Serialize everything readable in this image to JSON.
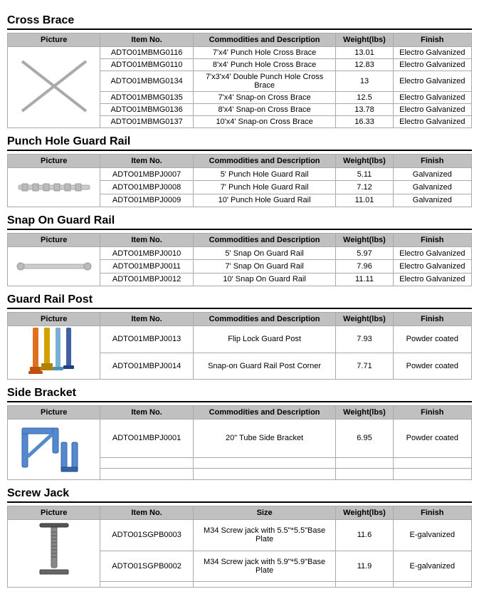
{
  "sections": [
    {
      "id": "cross-brace",
      "title": "Cross Brace",
      "headers": [
        "Picture",
        "Item No.",
        "Commodities and Description",
        "Weight(lbs)",
        "Finish"
      ],
      "rows": [
        {
          "item": "ADTO01MBMG0116",
          "desc": "7'x4' Punch Hole Cross Brace",
          "weight": "13.01",
          "finish": "Electro Galvanized"
        },
        {
          "item": "ADTO01MBMG0110",
          "desc": "8'x4' Punch Hole Cross Brace",
          "weight": "12.83",
          "finish": "Electro Galvanized"
        },
        {
          "item": "ADTO01MBMG0134",
          "desc": "7'x3'x4' Double Punch Hole Cross Brace",
          "weight": "13",
          "finish": "Electro Galvanized"
        },
        {
          "item": "ADTO01MBMG0135",
          "desc": "7'x4' Snap-on Cross Brace",
          "weight": "12.5",
          "finish": "Electro Galvanized"
        },
        {
          "item": "ADTO01MBMG0136",
          "desc": "8'x4' Snap-on Cross Brace",
          "weight": "13.78",
          "finish": "Electro Galvanized"
        },
        {
          "item": "ADTO01MBMG0137",
          "desc": "10'x4' Snap-on Cross Brace",
          "weight": "16.33",
          "finish": "Electro Galvanized"
        }
      ],
      "picture_rows": 6
    },
    {
      "id": "punch-hole-guard-rail",
      "title": "Punch Hole Guard Rail",
      "headers": [
        "Picture",
        "Item No.",
        "Commodities and Description",
        "Weight(lbs)",
        "Finish"
      ],
      "rows": [
        {
          "item": "ADTO01MBPJ0007",
          "desc": "5' Punch Hole Guard Rail",
          "weight": "5.11",
          "finish": "Galvanized"
        },
        {
          "item": "ADTO01MBPJ0008",
          "desc": "7' Punch Hole Guard Rail",
          "weight": "7.12",
          "finish": "Galvanized"
        },
        {
          "item": "ADTO01MBPJ0009",
          "desc": "10' Punch Hole Guard Rail",
          "weight": "11.01",
          "finish": "Galvanized"
        }
      ],
      "picture_rows": 3
    },
    {
      "id": "snap-on-guard-rail",
      "title": "Snap On Guard Rail",
      "headers": [
        "Picture",
        "Item No.",
        "Commodities and Description",
        "Weight(lbs)",
        "Finish"
      ],
      "rows": [
        {
          "item": "ADTO01MBPJ0010",
          "desc": "5' Snap On Guard Rail",
          "weight": "5.97",
          "finish": "Electro Galvanized"
        },
        {
          "item": "ADTO01MBPJ0011",
          "desc": "7' Snap On Guard Rail",
          "weight": "7.96",
          "finish": "Electro Galvanized"
        },
        {
          "item": "ADTO01MBPJ0012",
          "desc": "10' Snap On Guard Rail",
          "weight": "11.11",
          "finish": "Electro Galvanized"
        }
      ],
      "picture_rows": 3
    },
    {
      "id": "guard-rail-post",
      "title": "Guard Rail Post",
      "headers": [
        "Picture",
        "Item No.",
        "Commodities and Description",
        "Weight(lbs)",
        "Finish"
      ],
      "rows": [
        {
          "item": "ADTO01MBPJ0013",
          "desc": "Flip Lock Guard Post",
          "weight": "7.93",
          "finish": "Powder coated"
        },
        {
          "item": "ADTO01MBPJ0014",
          "desc": "Snap-on Guard Rail Post Corner",
          "weight": "7.71",
          "finish": "Powder coated"
        }
      ],
      "picture_rows": 2
    },
    {
      "id": "side-bracket",
      "title": "Side Bracket",
      "headers": [
        "Picture",
        "Item No.",
        "Commodities and Description",
        "Weight(lbs)",
        "Finish"
      ],
      "rows": [
        {
          "item": "ADTO01MBPJ0001",
          "desc": "20\" Tube Side Bracket",
          "weight": "6.95",
          "finish": "Powder coated"
        },
        {
          "item": "",
          "desc": "",
          "weight": "",
          "finish": ""
        },
        {
          "item": "",
          "desc": "",
          "weight": "",
          "finish": ""
        }
      ],
      "picture_rows": 3
    },
    {
      "id": "screw-jack",
      "title": "Screw Jack",
      "headers": [
        "Picture",
        "Item No.",
        "Size",
        "Weight(lbs)",
        "Finish"
      ],
      "rows": [
        {
          "item": "ADTO01SGPB0003",
          "desc": "M34 Screw jack with 5.5\"*5.5\"Base Plate",
          "weight": "11.6",
          "finish": "E-galvanized"
        },
        {
          "item": "ADTO01SGPB0002",
          "desc": "M34 Screw jack with 5.9\"*5.9\"Base Plate",
          "weight": "11.9",
          "finish": "E-galvanized"
        },
        {
          "item": "",
          "desc": "",
          "weight": "",
          "finish": ""
        }
      ],
      "picture_rows": 3
    }
  ]
}
